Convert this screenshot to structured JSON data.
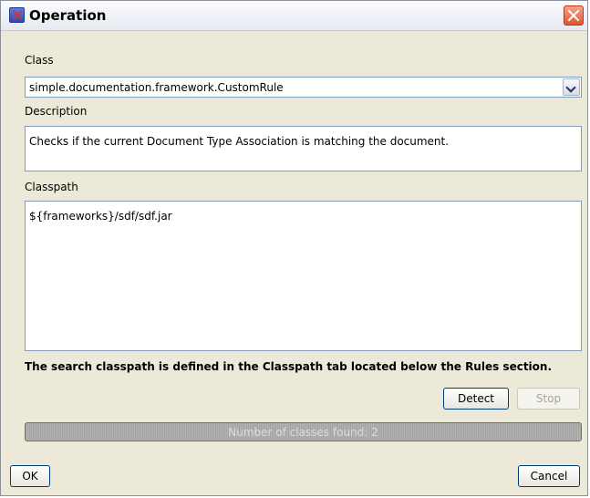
{
  "window": {
    "title": "Operation",
    "close_icon": "close-icon",
    "app_icon": "oxygen-x-icon"
  },
  "class_section": {
    "label": "Class",
    "value": "simple.documentation.framework.CustomRule"
  },
  "description_section": {
    "label": "Description",
    "value": "Checks if the current Document Type Association is matching the document."
  },
  "classpath_section": {
    "label": "Classpath",
    "value": "${frameworks}/sdf/sdf.jar"
  },
  "note": "The search classpath is defined in the Classpath tab located below the Rules section.",
  "buttons": {
    "detect": "Detect",
    "stop": "Stop",
    "ok": "OK",
    "cancel": "Cancel"
  },
  "progress": {
    "text": "Number of classes found: 2"
  },
  "colors": {
    "dialog_background": "#ece9d8",
    "field_border": "#7f9db9",
    "close_button": "#e0552e"
  }
}
